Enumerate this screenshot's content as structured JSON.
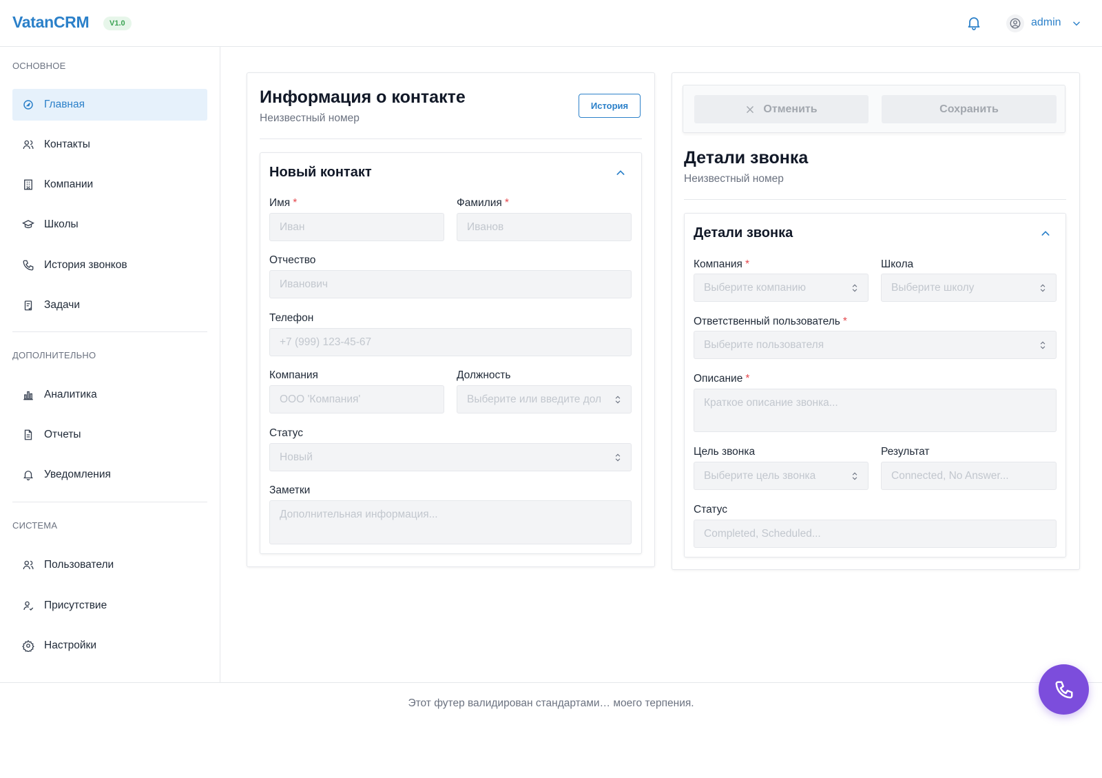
{
  "header": {
    "brand": "VatanCRM",
    "version": "V1.0",
    "user": "admin"
  },
  "sidebar": {
    "sections": [
      {
        "label": "ОСНОВНОЕ"
      },
      {
        "label": "ДОПОЛНИТЕЛЬНО"
      },
      {
        "label": "СИСТЕМА"
      }
    ],
    "items": [
      {
        "label": "Главная",
        "icon": "dashboard-icon",
        "active": true
      },
      {
        "label": "Контакты",
        "icon": "contacts-icon"
      },
      {
        "label": "Компании",
        "icon": "building-icon"
      },
      {
        "label": "Школы",
        "icon": "graduation-cap-icon"
      },
      {
        "label": "История звонков",
        "icon": "phone-icon"
      },
      {
        "label": "Задачи",
        "icon": "clipboard-icon"
      },
      {
        "label": "Аналитика",
        "icon": "bar-chart-icon"
      },
      {
        "label": "Отчеты",
        "icon": "document-icon"
      },
      {
        "label": "Уведомления",
        "icon": "bell-icon"
      },
      {
        "label": "Пользователи",
        "icon": "users-icon"
      },
      {
        "label": "Присутствие",
        "icon": "user-check-icon"
      },
      {
        "label": "Настройки",
        "icon": "gear-icon"
      }
    ]
  },
  "contact_card": {
    "title": "Информация о контакте",
    "subtitle": "Неизвестный номер",
    "history_button": "История",
    "section_title": "Новый контакт",
    "fields": {
      "first_name": {
        "label": "Имя",
        "placeholder": "Иван"
      },
      "last_name": {
        "label": "Фамилия",
        "placeholder": "Иванов"
      },
      "patronymic": {
        "label": "Отчество",
        "placeholder": "Иванович"
      },
      "phone": {
        "label": "Телефон",
        "placeholder": "+7 (999) 123-45-67"
      },
      "company": {
        "label": "Компания",
        "placeholder": "ООО 'Компания'"
      },
      "position": {
        "label": "Должность",
        "placeholder": "Выберите или введите дол"
      },
      "status": {
        "label": "Статус",
        "placeholder": "Новый"
      },
      "notes": {
        "label": "Заметки",
        "placeholder": "Дополнительная информация..."
      }
    }
  },
  "call_card": {
    "cancel_button": "Отменить",
    "save_button": "Сохранить",
    "title": "Детали звонка",
    "subtitle": "Неизвестный номер",
    "section_title": "Детали звонка",
    "fields": {
      "company": {
        "label": "Компания",
        "placeholder": "Выберите компанию"
      },
      "school": {
        "label": "Школа",
        "placeholder": "Выберите школу"
      },
      "responsible": {
        "label": "Ответственный пользователь",
        "placeholder": "Выберите пользователя"
      },
      "description": {
        "label": "Описание",
        "placeholder": "Краткое описание звонка..."
      },
      "purpose": {
        "label": "Цель звонка",
        "placeholder": "Выберите цель звонка"
      },
      "result": {
        "label": "Результат",
        "placeholder": "Connected, No Answer..."
      },
      "status": {
        "label": "Статус",
        "placeholder": "Completed, Scheduled..."
      }
    }
  },
  "footer": {
    "text": "Этот футер валидирован стандартами… моего терпения."
  },
  "colors": {
    "accent": "#2b80c9",
    "fab": "#7c4ddc",
    "required": "#e5484d"
  }
}
